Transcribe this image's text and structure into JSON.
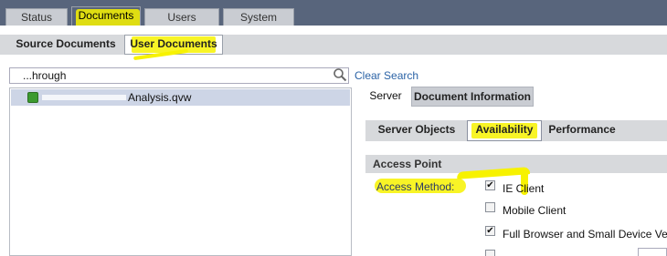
{
  "top_tabs": [
    "Status",
    "Documents",
    "Users",
    "System"
  ],
  "sub_tabs": [
    "Source Documents",
    "User Documents"
  ],
  "search": {
    "value": "...hrough",
    "clear_label": "Clear Search"
  },
  "tree": {
    "items": [
      {
        "label": "Analysis.qvw"
      }
    ]
  },
  "right_tabs": [
    "Server",
    "Document Information"
  ],
  "right_subtabs": [
    "Server Objects",
    "Availability",
    "Performance"
  ],
  "section_title": "Access Point",
  "access_method_label": "Access Method:",
  "access_options": [
    {
      "label": "IE Client",
      "checked": true
    },
    {
      "label": "Mobile Client",
      "checked": false
    },
    {
      "label": "Full Browser and Small Device Version",
      "checked": true
    }
  ],
  "colors": {
    "topbar": "#58657c",
    "highlight": "#f7f200",
    "link": "#2b63a6"
  }
}
